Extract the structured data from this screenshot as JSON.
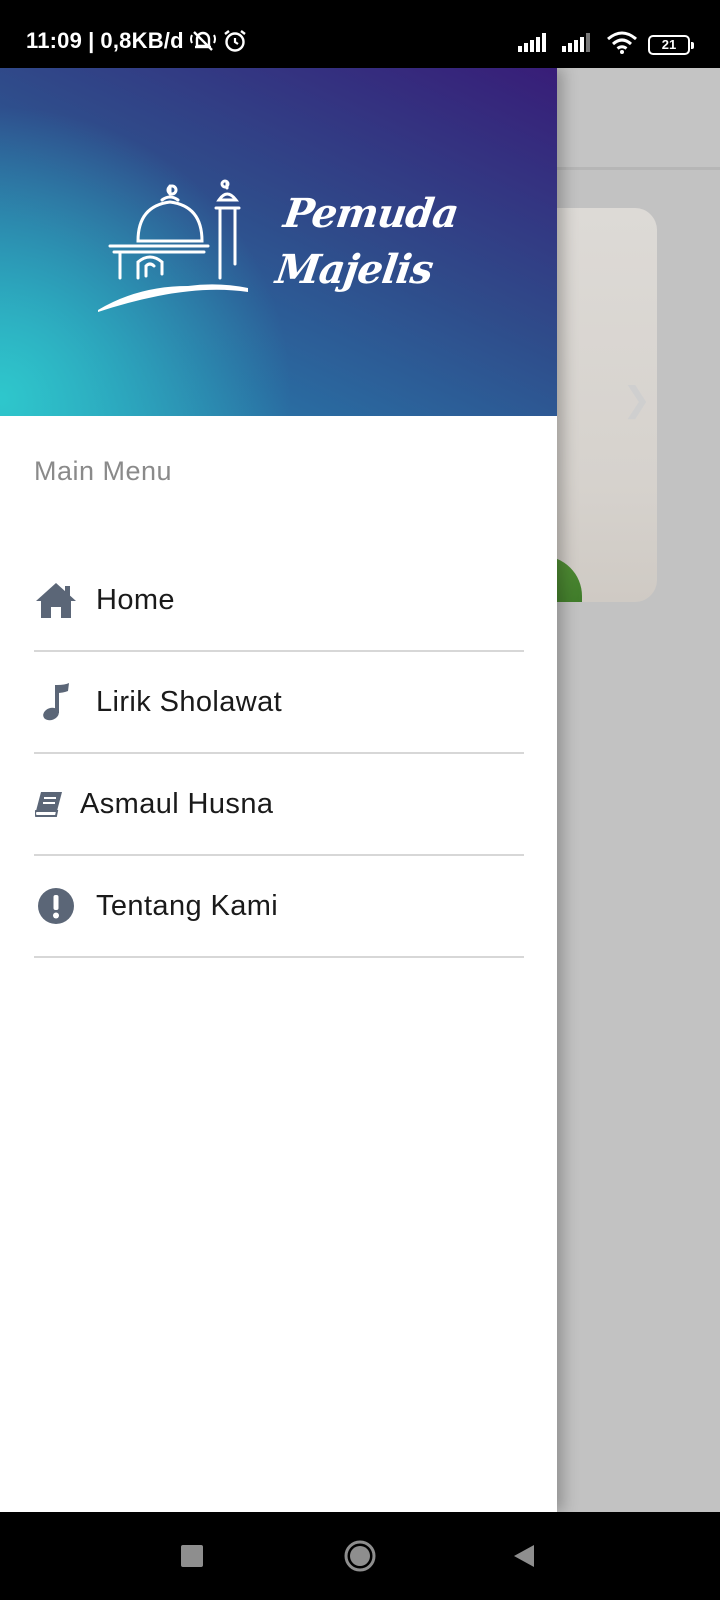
{
  "status_bar": {
    "time": "11:09",
    "separator": "|",
    "speed": "0,8KB/d",
    "battery_level": "21",
    "icons": [
      "mute-icon",
      "alarm-icon",
      "signal-icon",
      "signal-icon",
      "wifi-icon",
      "battery-icon"
    ]
  },
  "drawer": {
    "brand_line1": "Pemuda",
    "brand_line2": "Majelis",
    "menu_title": "Main Menu",
    "items": [
      {
        "label": "Home",
        "icon": "home-icon"
      },
      {
        "label": "Lirik Sholawat",
        "icon": "music-note-icon"
      },
      {
        "label": "Asmaul Husna",
        "icon": "book-icon"
      },
      {
        "label": "Tentang Kami",
        "icon": "info-exclamation-icon"
      }
    ],
    "icon_color": "#5b6677"
  },
  "colors": {
    "header_gradient_start": "#2ec7cc",
    "header_gradient_end": "#381d78",
    "scrim": "#c2c2c2"
  },
  "nav_bar": {
    "buttons": [
      "recents-button",
      "home-button",
      "back-button"
    ]
  }
}
